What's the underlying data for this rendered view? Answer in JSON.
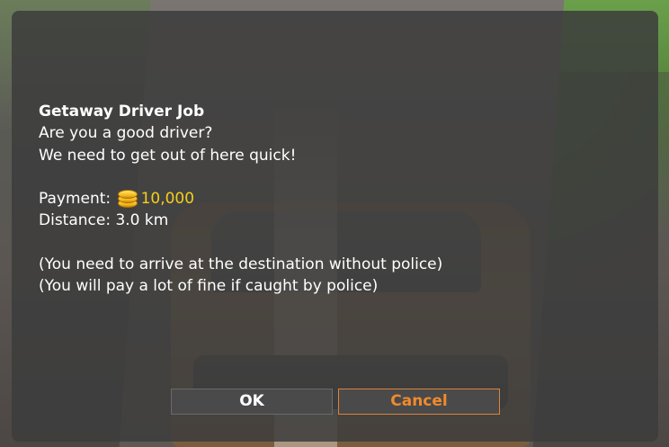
{
  "dialog": {
    "title": "Getaway Driver Job",
    "lines": [
      "Are you a good driver?",
      "We need to get out of here quick!"
    ],
    "payment_label": "Payment:",
    "payment_amount": "10,000",
    "payment_icon": "coin-stack-icon",
    "distance": "Distance: 3.0 km",
    "notes": [
      "(You need to arrive at the destination without police)",
      "(You will pay a lot of fine if caught by police)"
    ]
  },
  "buttons": {
    "ok_label": "OK",
    "cancel_label": "Cancel"
  },
  "colors": {
    "money": "#f5cf1a",
    "cancel_accent": "#f08a2c",
    "dialog_bg": "#3c3c3c"
  }
}
